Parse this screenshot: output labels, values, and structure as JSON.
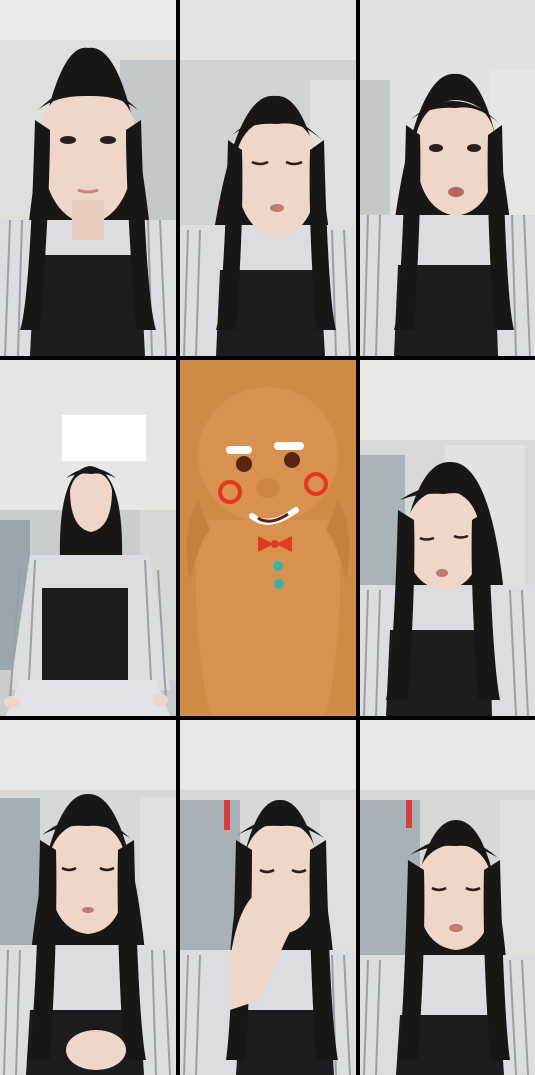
{
  "grid": {
    "columns": 3,
    "rows": 3,
    "tiles": [
      {
        "index": 1,
        "subject": "person-portrait",
        "pose": "front-neutral"
      },
      {
        "index": 2,
        "subject": "person-portrait",
        "pose": "eyes-closed-head-tilt"
      },
      {
        "index": 3,
        "subject": "person-portrait",
        "pose": "looking-side-mouth-open"
      },
      {
        "index": 4,
        "subject": "person-portrait",
        "pose": "wide-shot-standing"
      },
      {
        "index": 5,
        "subject": "gingerbread-face-filter",
        "pose": "cartoon"
      },
      {
        "index": 6,
        "subject": "person-portrait",
        "pose": "head-tilt-eyes-down"
      },
      {
        "index": 7,
        "subject": "person-portrait",
        "pose": "hands-clasped"
      },
      {
        "index": 8,
        "subject": "person-portrait",
        "pose": "hand-over-mouth"
      },
      {
        "index": 9,
        "subject": "person-portrait",
        "pose": "eyes-closed-pout"
      }
    ]
  },
  "colors": {
    "wall": "#c9cdcc",
    "ceiling": "#e6e7e4",
    "door": "#9aa6ad",
    "hair": "#191616",
    "skin": "#eed7c9",
    "shirt-stripe": "#e9e9eb",
    "overalls": "#1c1c1e",
    "gingerbread-bg": "#d08a45",
    "gingerbread-body": "#d89150",
    "icing": "#ffffff",
    "cheek-red": "#e4361e",
    "bowtie-red": "#e23b24",
    "button-teal": "#3bb3a2"
  }
}
